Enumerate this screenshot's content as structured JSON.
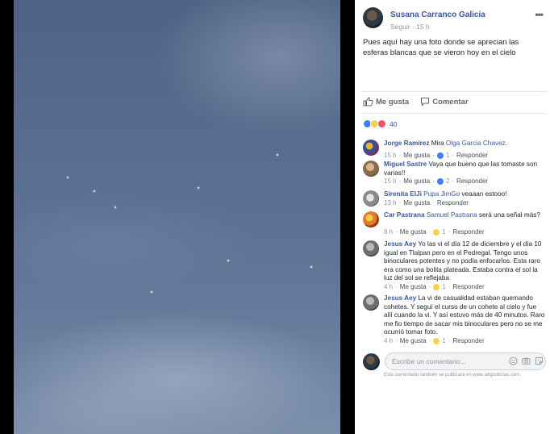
{
  "post": {
    "author": "Susana Carranco Galicia",
    "follow_label": "Seguir",
    "time": "15 h",
    "text": "Pues aquí hay una foto donde se aprecian las esferas blancas que se vieron hoy en el cielo",
    "more_icon": "more-horizontal-icon",
    "like_label": "Me gusta",
    "comment_label": "Comentar",
    "reactions_count": "40",
    "reaction_types": [
      "like-reaction-icon",
      "wow-reaction-icon",
      "love-reaction-icon"
    ]
  },
  "comments": [
    {
      "author": "Jorge Ramirez",
      "text_prefix": "Mira ",
      "mention": "Olga Garcia Chavez",
      "text": ".",
      "time": "15 h",
      "like_label": "Me gusta",
      "reactions": "1",
      "reaction_icon": "like-reaction-icon",
      "reply_label": "Responder"
    },
    {
      "author": "Miguel Sastre",
      "text_prefix": "",
      "mention": "",
      "text": "Vaya que bueno que las tomaste son varias!!",
      "time": "15 h",
      "like_label": "Me gusta",
      "reactions": "2",
      "reaction_icon": "like-reaction-icon",
      "reply_label": "Responder"
    },
    {
      "author": "Sirenita ElJi",
      "text_prefix": "",
      "mention": "Pupa JimGo",
      "text": " veaaan estooo!",
      "time": "13 h",
      "like_label": "Me gusta",
      "reactions": "",
      "reaction_icon": "",
      "reply_label": "Responder"
    },
    {
      "author": "Car Pastrana",
      "text_prefix": "",
      "mention": "Samuel Pastrana",
      "text": " será una señal más?",
      "time": "8 h",
      "like_label": "Me gusta",
      "reactions": "1",
      "reaction_icon": "haha-reaction-icon",
      "reply_label": "Responder"
    },
    {
      "author": "Jesus Aey",
      "text_prefix": "",
      "mention": "",
      "text": "Yo las vi el día 12 de diciembre y el día 10 igual en Tlalpan pero en el Pedregal. Tengo unos binoculares potentes y no podía enfocarlos. Esta raro era como una bolita plateada. Estaba contra el sol la luz del sol se reflejaba",
      "time": "4 h",
      "like_label": "Me gusta",
      "reactions": "1",
      "reaction_icon": "wow-reaction-icon",
      "reply_label": "Responder"
    },
    {
      "author": "Jesus Aey",
      "text_prefix": "",
      "mention": "",
      "text": "La vi de casualidad estaban quemando cohetes. Y seguí el curso de un cohete al cielo y fue allí cuando la vi. Y así estuvo más de 40 minutos. Raro me fio tiempo de sacar mis binoculares pero no se me ocurrió tomar foto.",
      "time": "4 h",
      "like_label": "Me gusta",
      "reactions": "1",
      "reaction_icon": "wow-reaction-icon",
      "reply_label": "Responder"
    }
  ],
  "composer": {
    "placeholder": "Escribe un comentario...",
    "icons": [
      "emoji-icon",
      "camera-icon",
      "sticker-icon"
    ],
    "note": "Este comentario también se publicará en www.adgnoticias.com."
  },
  "colors": {
    "link": "#385898",
    "meta": "#90949c",
    "like": "#4080ff",
    "wow": "#fbd051",
    "love": "#f25268"
  }
}
